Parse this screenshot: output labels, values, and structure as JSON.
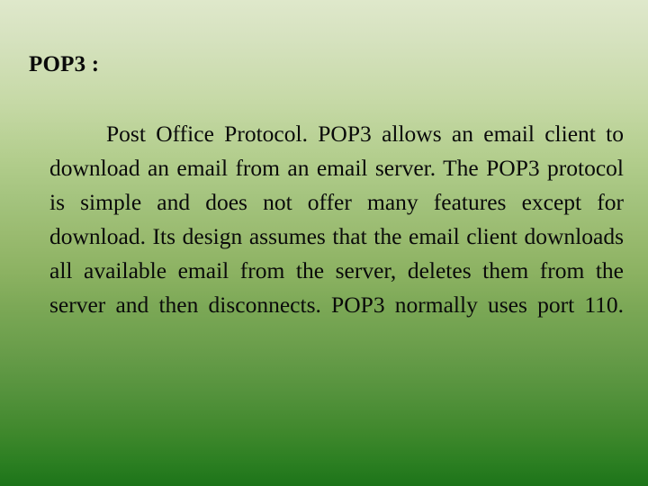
{
  "slide": {
    "title": "POP3 :",
    "body": "Post Office Protocol. POP3 allows an email client to download an email from an email server. The POP3 protocol is simple and does not offer many features except for download. Its design assumes that the email client downloads all available email from the server, deletes them from the server and then disconnects. POP3 normally uses port 110.",
    "body_lines": [
      "Post Office Protocol. POP3 allows an email",
      "client to download an email from an email server.",
      "The POP3 protocol is simple and does not offer",
      "many features except for download. Its design",
      "assumes that the email client downloads all",
      "available email from the server, deletes them",
      "from the server and then disconnects. POP3",
      "normally uses port 110."
    ],
    "colors": {
      "background_top": "#dfe8cb",
      "background_mid": "#9abb70",
      "background_bottom": "#1d7419",
      "text": "#0a0a0a",
      "title_text": "#0a0a0a"
    }
  }
}
